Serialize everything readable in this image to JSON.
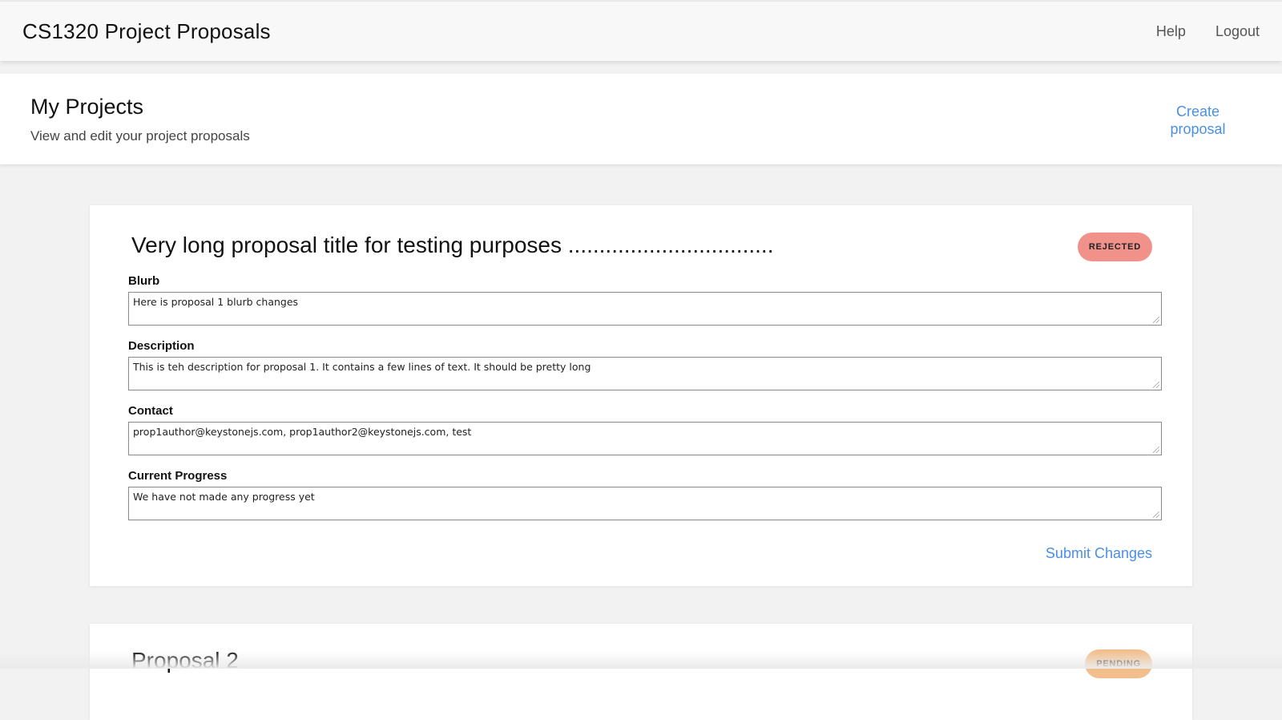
{
  "navbar": {
    "brand": "CS1320 Project Proposals",
    "links": [
      "Help",
      "Logout"
    ]
  },
  "header": {
    "title": "My Projects",
    "subtitle": "View and edit your project proposals",
    "create_label": "Create proposal"
  },
  "proposals": [
    {
      "title": "Very long proposal title for testing purposes .................................",
      "status": "REJECTED",
      "fields": [
        {
          "label": "Blurb",
          "value": "Here is proposal 1 blurb changes"
        },
        {
          "label": "Description",
          "value": "This is teh description for proposal 1. It contains a few lines of text. It should be pretty long"
        },
        {
          "label": "Contact",
          "value": "prop1author@keystonejs.com, prop1author2@keystonejs.com, test"
        },
        {
          "label": "Current Progress",
          "value": "We have not made any progress yet"
        }
      ],
      "submit_label": "Submit Changes"
    },
    {
      "title": "Proposal 2",
      "status": "PENDING"
    }
  ],
  "colors": {
    "link": "#4a90e2",
    "rejected_badge": "#f0918a",
    "pending_badge": "#f2bf8c"
  }
}
